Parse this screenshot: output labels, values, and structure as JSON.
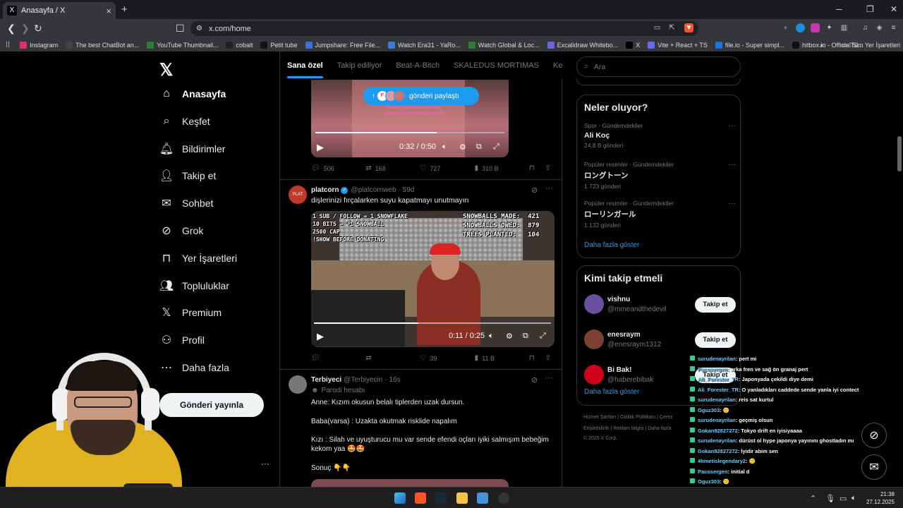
{
  "browser": {
    "tab_title": "Anasayfa / X",
    "tab_close": "×",
    "new_tab": "+",
    "url": "x.com/home",
    "bookmarks": [
      {
        "label": "Instagram",
        "color": "#e1306c"
      },
      {
        "label": "The best ChatBot an...",
        "color": "#444"
      },
      {
        "label": "YouTube Thumbnail...",
        "color": "#2e7d32"
      },
      {
        "label": "cobalt",
        "color": "#222"
      },
      {
        "label": "Petit tube",
        "color": "#111"
      },
      {
        "label": "Jumpshare: Free File...",
        "color": "#3f6fd8"
      },
      {
        "label": "Watch Era31 - YaRo...",
        "color": "#3a7bd5"
      },
      {
        "label": "Watch Global & Loc...",
        "color": "#2e7d32"
      },
      {
        "label": "Excalidraw Whitebo...",
        "color": "#6965db"
      },
      {
        "label": "X",
        "color": "#000"
      },
      {
        "label": "Vite + React + TS",
        "color": "#646cff"
      },
      {
        "label": "file.io - Super simpl...",
        "color": "#1a73e8"
      },
      {
        "label": "hitbox.io - Official Si...",
        "color": "#111"
      }
    ],
    "bookmarks_more": "»",
    "all_bookmarks": "Tüm Yer İşaretleri"
  },
  "nav": {
    "items": [
      {
        "label": "Anasayfa",
        "icon": "home-icon"
      },
      {
        "label": "Keşfet",
        "icon": "search-icon"
      },
      {
        "label": "Bildirimler",
        "icon": "bell-icon"
      },
      {
        "label": "Takip et",
        "icon": "follow-icon"
      },
      {
        "label": "Sohbet",
        "icon": "mail-icon"
      },
      {
        "label": "Grok",
        "icon": "grok-icon"
      },
      {
        "label": "Yer İşaretleri",
        "icon": "bookmark-icon"
      },
      {
        "label": "Topluluklar",
        "icon": "communities-icon"
      },
      {
        "label": "Premium",
        "icon": "x-icon"
      },
      {
        "label": "Profil",
        "icon": "person-icon"
      },
      {
        "label": "Daha fazla",
        "icon": "more-circle-icon"
      }
    ],
    "post_button": "Gönderi yayınla",
    "more": "···"
  },
  "timeline": {
    "tabs": [
      "Sana özel",
      "Takip ediliyor",
      "Beat-A-Bitch",
      "SKALEDUS MORTIMAS",
      "Kend"
    ],
    "share_pill": "gönderi paylaştı",
    "post1": {
      "caption": "chat got kara boyu tarin verip sonrasında sorumluluğu reddetti",
      "time": "0:32 / 0:50",
      "progress": 0.64,
      "replies": "506",
      "reposts": "168",
      "likes": "727",
      "views": "310 B"
    },
    "post2": {
      "name": "platcorn",
      "handle": "@platcornweb",
      "age": "· 59d",
      "text": "dişlerinizi fırçalarken suyu kapatmayı unutmayın",
      "overlay_left": "1 SUB / FOLLOW = 1 SNOWFLAKE\n10 BITS = +1 SNOWBALL\n2500 CAP\n!SHOW BEFORE DONATING",
      "overlay_right": "SNOWBALLS MADE:  421\nSNOWBALLS OWED:  879\nTREES PLANTED:   104",
      "time": "0:11 / 0:25",
      "progress": 0.44,
      "replies": "",
      "reposts": "",
      "likes": "39",
      "views": "11 B"
    },
    "post3": {
      "name": "Terbiyeci",
      "handle": "@Terbiyecin",
      "age": "· 16s",
      "badge": "Parodi hesabı",
      "lines": [
        "Anne: Kızım okusun belalı tiplerden uzak dursun.",
        "Baba(varsa) : Uzakta okutmak risklide napalım",
        "Kızı : Silah ve uyuşturucu mu var sende efendi oçları iyiki salmışım bebeğim kekom yaa 🤩🤩",
        "Sonuç 👇👇"
      ]
    }
  },
  "right": {
    "search_placeholder": "Ara",
    "trends_title": "Neler oluyor?",
    "trends": [
      {
        "context": "Spor · Gündemdekiler",
        "title": "Ali Koç",
        "count": "24,8 B gönderi"
      },
      {
        "context": "Popüler resimler · Gündemdekiler",
        "title": "ロングトーン",
        "count": "1.723 gönderi"
      },
      {
        "context": "Popüler resimler · Gündemdekiler",
        "title": "ローリンガール",
        "count": "1.132 gönderi"
      }
    ],
    "trends_more": "Daha fazla göster",
    "who_title": "Kimi takip etmeli",
    "who": [
      {
        "name": "vishnu",
        "handle": "@mmeandthedevil",
        "button": "Takip et",
        "color": "#6a4fa0"
      },
      {
        "name": "enesraym",
        "handle": "@enesraym1312",
        "button": "Takip et",
        "color": "#7a4030"
      },
      {
        "name": "Bi Bak!",
        "handle": "@haberebibak",
        "button": "Takip et",
        "color": "#d0021b"
      }
    ],
    "who_more": "Daha fazla göster",
    "footer": [
      "Hizmet Şartları  |  Gizlilik Politikası  |  Çerez",
      "Erişilebilirlik  |  Reklam bilgisi  |  Daha fazla",
      "© 2025 X Corp."
    ]
  },
  "chat": [
    {
      "user": "surudenayrilan",
      "msg": ": pert mi"
    },
    {
      "user": "Pacosergen",
      "msg": ": arka fren ve sağ ön granaj pert"
    },
    {
      "user": "Ali_Forester_TR",
      "msg": ": Japonyada çekildi diye demi"
    },
    {
      "user": "Ali_Forester_TR",
      "msg": ": O yanladıkları caddede sende yanla iyi contect"
    },
    {
      "user": "surudenayrilan",
      "msg": ": reis sat kurtul"
    },
    {
      "user": "Oguz303",
      "msg": ": 🙂"
    },
    {
      "user": "surudenayrilan",
      "msg": ": geçmiş olsun"
    },
    {
      "user": "Gokan92827272",
      "msg": ": Tokyo drift en iyisiyaaaa"
    },
    {
      "user": "surudenayrilan",
      "msg": ": dürüst ol hype japonya yayınını ghostladın mı"
    },
    {
      "user": "Gokan92827272",
      "msg": ": İyidir abim sen"
    },
    {
      "user": "4hmetislegendary2",
      "msg": ": 🙂"
    },
    {
      "user": "Pacosergen",
      "msg": ": initial d"
    },
    {
      "user": "Oguz303",
      "msg": ": 🙂"
    },
    {
      "user": "4hmetislegendary2",
      "msg": ": 🙂"
    },
    {
      "user": "Oguz303",
      "msg": ": 🙂"
    }
  ],
  "taskbar": {
    "time": "21:38",
    "date": "27.12.2025"
  }
}
